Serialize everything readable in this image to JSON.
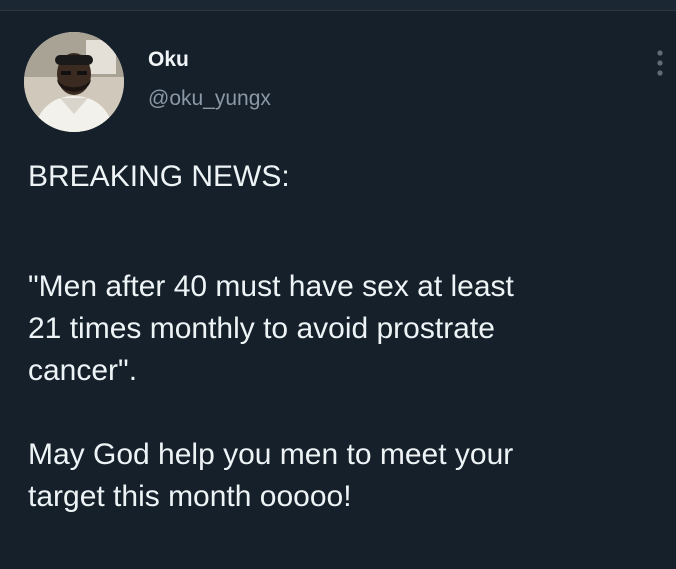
{
  "tweet": {
    "author": {
      "name": "Oku",
      "handle": "@oku_yungx"
    },
    "icons": {
      "avatar": "profile-photo",
      "more": "more-options-icon"
    },
    "body": {
      "headline": "BREAKING NEWS:",
      "quote_lines": [
        "\"Men after 40 must have sex at least",
        "21 times monthly to avoid prostrate",
        "cancer\"."
      ],
      "closing_lines": [
        "May God help you men to meet your",
        "target this month ooooo!"
      ]
    }
  },
  "colors": {
    "background": "#15202b",
    "text_primary": "#eef3f6",
    "text_secondary": "#8b98a5"
  }
}
